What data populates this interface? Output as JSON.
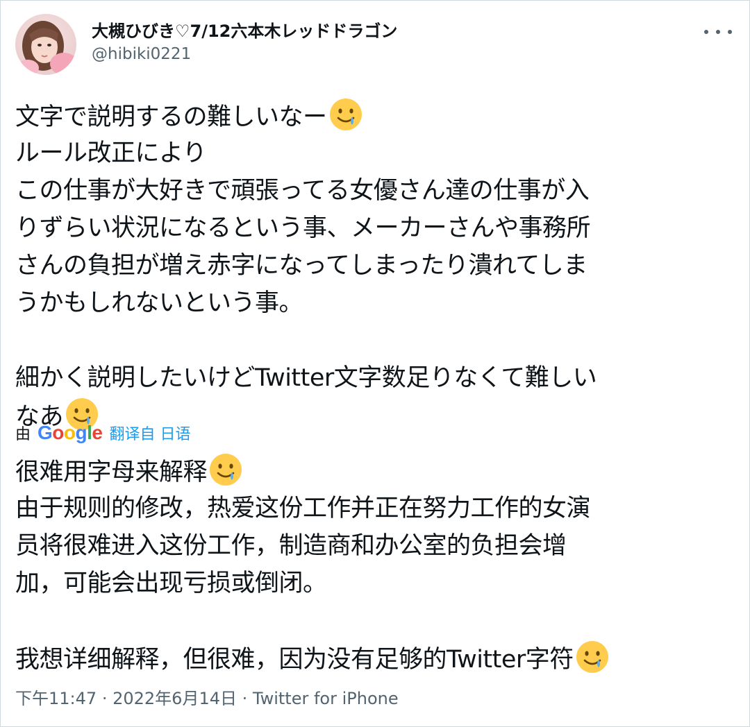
{
  "user": {
    "display_name": "大槻ひびき♡7/12六本木レッドドラゴン",
    "handle": "@hibiki0221"
  },
  "tweet": {
    "original_lines": [
      "文字で説明するの難しいなー",
      "ルール改正により",
      "この仕事が大好きで頑張ってる女優さん達の仕事が入",
      "りずらい状況になるという事、メーカーさんや事務所",
      "さんの負担が増え赤字になってしまったり潰れてしま",
      "うかもしれないという事。",
      "細かく説明したいけどTwitter文字数足りなくて難しい",
      "なあ"
    ],
    "emoji": "slightly-smiling-face-with-tear-icon"
  },
  "translation": {
    "by_label": "由",
    "provider": "Google",
    "link_text": "翻译自 日语",
    "lines": [
      "很难用字母来解释",
      "由于规则的修改，热爱这份工作并正在努力工作的女演",
      "员将很难进入这份工作，制造商和办公室的负担会增",
      "加，可能会出现亏损或倒闭。",
      "我想详细解释，但很难，因为没有足够的Twitter字符"
    ]
  },
  "meta": {
    "time": "下午11:47",
    "separator": "·",
    "date": "2022年6月14日",
    "source": "Twitter for iPhone"
  },
  "colors": {
    "text": "#0f1419",
    "secondary": "#536471",
    "link": "#1d9bf0",
    "border": "#cfd9de"
  }
}
